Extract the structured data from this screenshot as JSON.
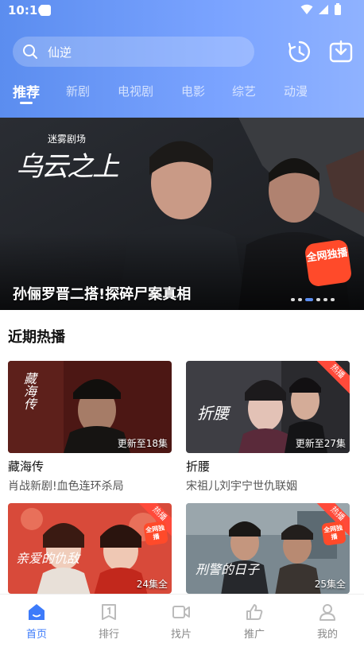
{
  "status_bar": {
    "time": "10:16"
  },
  "search": {
    "query": "仙逆"
  },
  "tabs": [
    {
      "label": "推荐",
      "active": true
    },
    {
      "label": "新剧"
    },
    {
      "label": "电视剧"
    },
    {
      "label": "电影"
    },
    {
      "label": "综艺"
    },
    {
      "label": "动漫"
    }
  ],
  "banner": {
    "caption": "孙俪罗晋二搭!探碎尸案真相",
    "logo_text": "迷雾剧场",
    "title_art": "乌云之上",
    "stamp": "全网独播",
    "dots_total": 6,
    "dots_active_index": 2
  },
  "section": {
    "title": "近期热播"
  },
  "cards": [
    {
      "title": "藏海传",
      "desc": "肖战新剧!血色连环杀局",
      "episodes": "更新至18集",
      "thumb_text": "藏海传",
      "hot": false
    },
    {
      "title": "折腰",
      "desc": "宋祖儿刘宇宁世仇联姻",
      "episodes": "更新至27集",
      "thumb_text": "折腰",
      "hot": true,
      "hot_label": "热播"
    },
    {
      "title": "",
      "desc": "",
      "episodes": "24集全",
      "thumb_text": "亲爱的仇敌",
      "hot": true,
      "hot_label": "热播",
      "stamp": "全网独播"
    },
    {
      "title": "",
      "desc": "",
      "episodes": "25集全",
      "thumb_text": "刑警的日子",
      "hot": true,
      "hot_label": "热播",
      "stamp": "全网独播"
    }
  ],
  "bottom_nav": [
    {
      "label": "首页",
      "icon": "home-icon",
      "active": true
    },
    {
      "label": "排行",
      "icon": "ranking-icon"
    },
    {
      "label": "找片",
      "icon": "video-camera-icon"
    },
    {
      "label": "推广",
      "icon": "thumbs-up-icon"
    },
    {
      "label": "我的",
      "icon": "user-icon"
    }
  ],
  "colors": {
    "accent": "#3d7bfa",
    "header_start": "#5b8def",
    "header_end": "#8fb2ff",
    "hot": "#ff4a3a"
  }
}
